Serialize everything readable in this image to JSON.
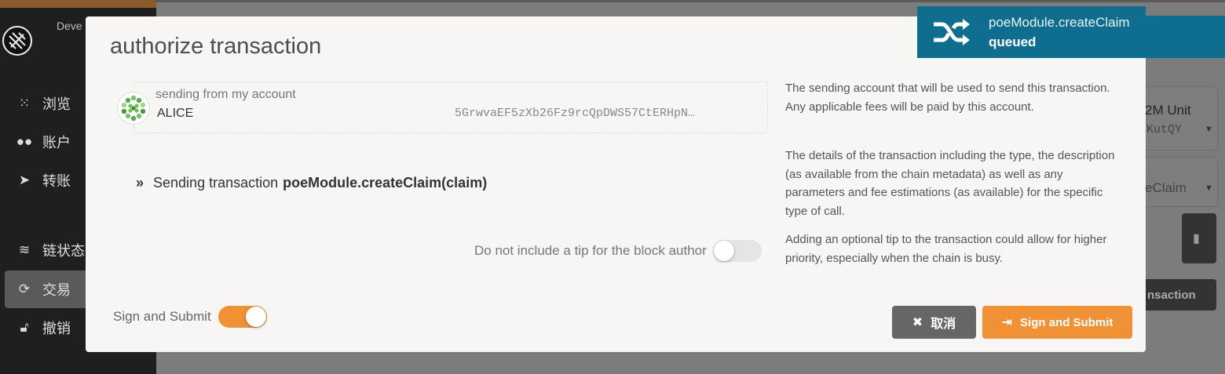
{
  "sidebar": {
    "chain_name": "Deve",
    "items": [
      {
        "label": "浏览",
        "icon": "grid-icon"
      },
      {
        "label": "账户",
        "icon": "users-icon"
      },
      {
        "label": "转账",
        "icon": "send-icon"
      },
      {
        "label": "链状态",
        "icon": "database-icon"
      },
      {
        "label": "交易",
        "icon": "sync-icon",
        "active": true
      },
      {
        "label": "撤销",
        "icon": "unlock-icon"
      }
    ]
  },
  "background": {
    "unit_text": "2M Unit",
    "addr_fragment": "KutQY",
    "method_fragment": "eClaim",
    "submit_fragment": "nsaction"
  },
  "modal": {
    "title": "authorize transaction",
    "account": {
      "label": "sending from my account",
      "name": "ALICE",
      "address": "5GrwvaEF5zXb26Fz9rcQpDWS57CtERHpN…"
    },
    "transaction": {
      "prefix": "Sending transaction",
      "call": "poeModule.createClaim(claim)"
    },
    "tip": {
      "label": "Do not include a tip for the block author",
      "enabled": false
    },
    "help": {
      "account": "The sending account that will be used to send this transaction. Any applicable fees will be paid by this account.",
      "details": "The details of the transaction including the type, the description (as available from the chain metadata) as well as any parameters and fee estimations (as available) for the specific type of call.",
      "tip": "Adding an optional tip to the transaction could allow for higher priority, especially when the chain is busy."
    },
    "sign_toggle": {
      "label": "Sign and Submit",
      "enabled": true
    },
    "buttons": {
      "cancel": "取消",
      "submit": "Sign and Submit"
    }
  },
  "toast": {
    "method": "poeModule.createClaim",
    "status": "queued"
  },
  "colors": {
    "accent": "#f19135",
    "toast": "#0f6e8f",
    "sidebar": "#1f1f1f"
  }
}
